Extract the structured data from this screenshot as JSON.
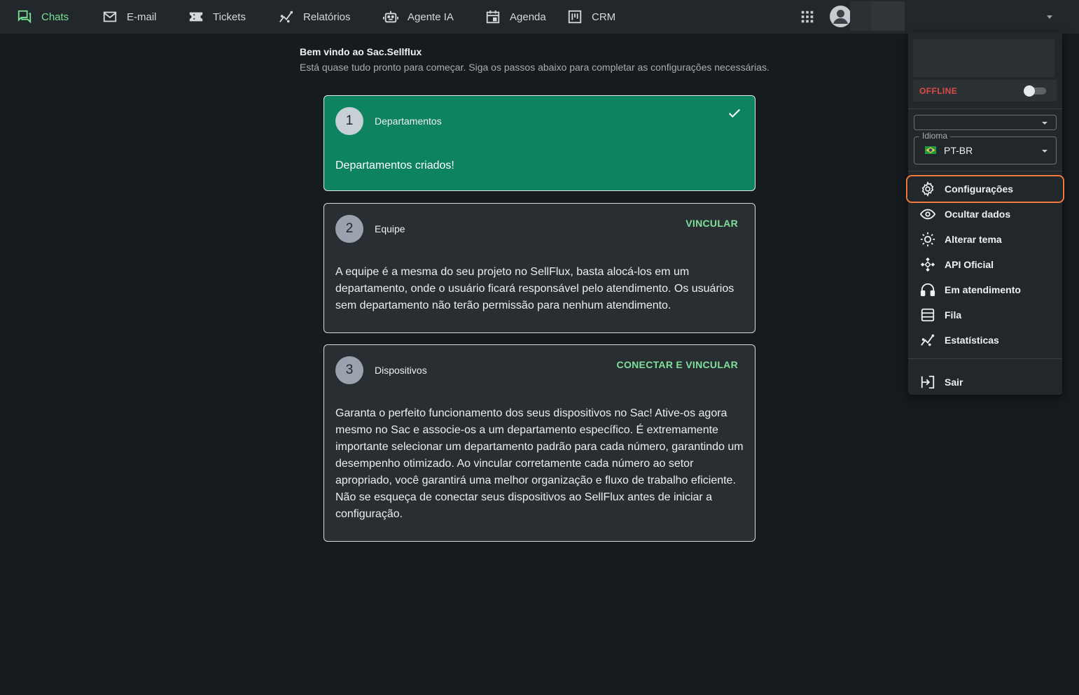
{
  "nav": {
    "items": [
      {
        "label": "Chats",
        "icon": "chat-icon",
        "active": true
      },
      {
        "label": "E-mail",
        "icon": "mail-icon"
      },
      {
        "label": "Tickets",
        "icon": "ticket-icon"
      },
      {
        "label": "Relatórios",
        "icon": "chart-line-icon"
      },
      {
        "label": "Agente IA",
        "icon": "robot-icon"
      },
      {
        "label": "Agenda",
        "icon": "calendar-icon"
      },
      {
        "label": "CRM",
        "icon": "kanban-icon"
      }
    ],
    "apps_icon": "apps-grid-icon",
    "avatar_icon": "account-circle-icon",
    "active_color": "#7be095"
  },
  "welcome": {
    "title": "Bem vindo ao Sac.Sellflux",
    "subtitle": "Está quase tudo pronto para começar. Siga os passos abaixo para completar as configurações necessárias."
  },
  "steps": [
    {
      "number": "1",
      "title": "Departamentos",
      "status": "done",
      "body": "Departamentos criados!"
    },
    {
      "number": "2",
      "title": "Equipe",
      "action": "VINCULAR",
      "body": "A equipe é a mesma do seu projeto no SellFlux, basta alocá-los em um departamento, onde o usuário ficará responsável pelo atendimento. Os usuários sem departamento não terão permissão para nenhum atendimento."
    },
    {
      "number": "3",
      "title": "Dispositivos",
      "action": "CONECTAR E VINCULAR",
      "body": "Garanta o perfeito funcionamento dos seus dispositivos no Sac! Ative-os agora mesmo no Sac e associe-os a um departamento específico. É extremamente importante selecionar um departamento padrão para cada número, garantindo um desempenho otimizado. Ao vincular corretamente cada número ao setor apropriado, você garantirá uma melhor organização e fluxo de trabalho eficiente. Não se esqueça de conectar seus dispositivos ao SellFlux antes de iniciar a configuração."
    }
  ],
  "menu": {
    "status": {
      "label": "OFFLINE",
      "on": false,
      "color": "#e04c45"
    },
    "first_select_value": "",
    "language": {
      "label": "Idioma",
      "value": "PT-BR",
      "flag": "brazil-flag-icon"
    },
    "items": [
      {
        "label": "Configurações",
        "icon": "gear-icon",
        "highlighted": true
      },
      {
        "label": "Ocultar dados",
        "icon": "eye-icon"
      },
      {
        "label": "Alterar tema",
        "icon": "sun-icon"
      },
      {
        "label": "API Oficial",
        "icon": "api-diamond-icon"
      },
      {
        "label": "Em atendimento",
        "icon": "headset-icon"
      },
      {
        "label": "Fila",
        "icon": "queue-list-icon"
      },
      {
        "label": "Estatísticas",
        "icon": "chart-line-icon"
      }
    ],
    "logout": {
      "label": "Sair",
      "icon": "logout-icon"
    },
    "highlight_color": "#f07a3c"
  }
}
